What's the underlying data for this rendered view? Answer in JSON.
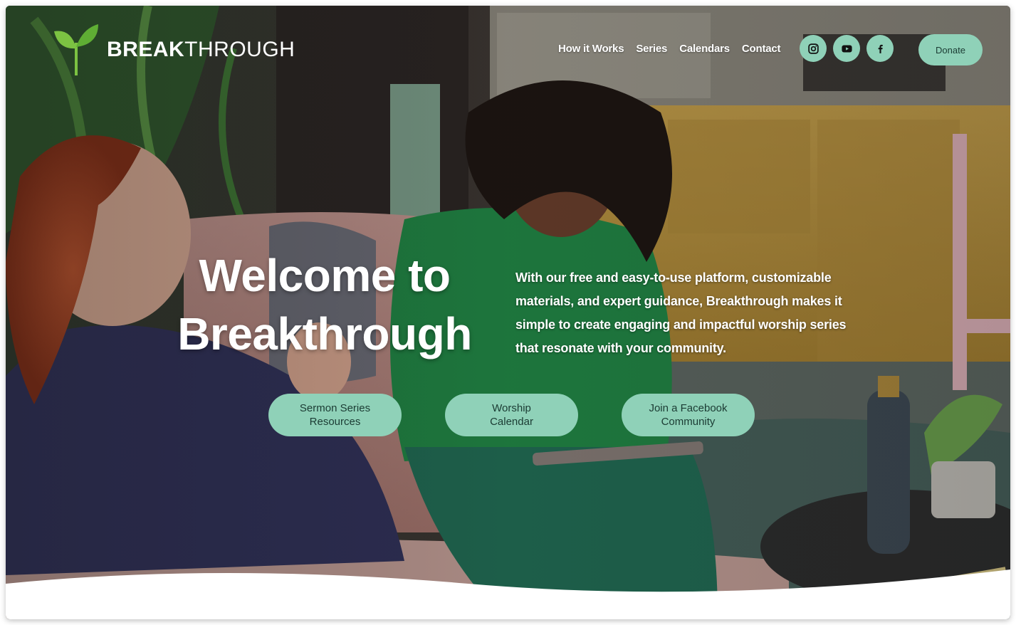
{
  "brand": {
    "name_bold": "BREAK",
    "name_light": "THROUGH",
    "accent": "#8fd1b8",
    "leaf_color": "#7cc242"
  },
  "nav": {
    "items": [
      "How it Works",
      "Series",
      "Calendars",
      "Contact"
    ]
  },
  "socials": [
    {
      "icon": "instagram-icon"
    },
    {
      "icon": "youtube-icon"
    },
    {
      "icon": "facebook-icon"
    }
  ],
  "donate_label": "Donate",
  "hero": {
    "title": "Welcome to Breakthrough",
    "copy": "With our free and easy-to-use platform, customizable materials, and expert guidance, Breakthrough makes it simple to create engaging and impactful worship series that resonate with your community."
  },
  "cta": [
    {
      "label": "Sermon Series\nResources"
    },
    {
      "label": "Worship\nCalendar"
    },
    {
      "label": "Join a Facebook\nCommunity"
    }
  ]
}
